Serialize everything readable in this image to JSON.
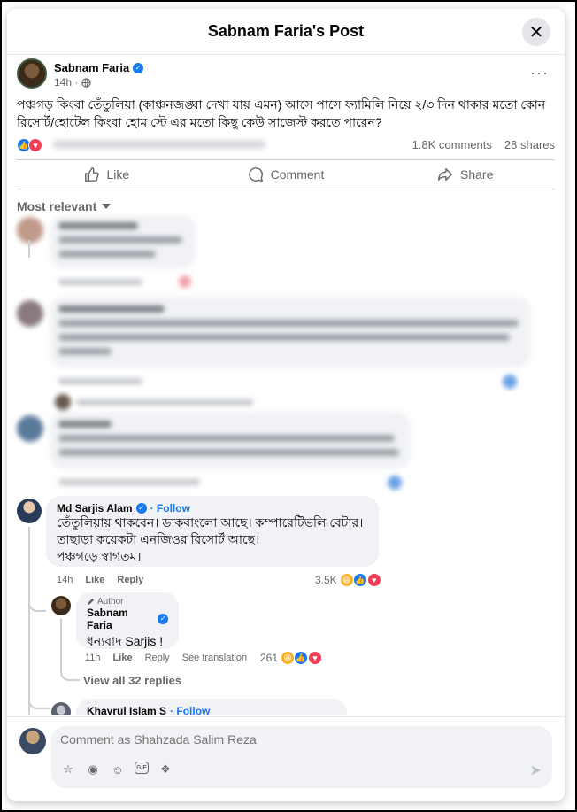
{
  "modal": {
    "title": "Sabnam Faria's Post",
    "close_label": "✕"
  },
  "post": {
    "author": "Sabnam Faria",
    "time": "14h ·",
    "more": "···",
    "text": "পঞ্চগড় কিংবা তেঁতুলিয়া (কাঞ্চনজঙ্ঘা দেখা যায় এমন) আসে পাসে ফ্যামিলি নিয়ে ২/৩ দিন থাকার মতো কোন রিসোর্ট/হোটেল কিংবা হোম স্টে এর মতো কিছু কেউ সাজেস্ট করতে পারেন?",
    "comments_count": "1.8K comments",
    "shares_count": "28 shares"
  },
  "actions": {
    "like": "Like",
    "comment": "Comment",
    "share": "Share"
  },
  "sort": {
    "label": "Most relevant"
  },
  "comments": [
    {
      "name": "Md Sarjis Alam",
      "follow": "· Follow",
      "lines": [
        "তেঁতুলিয়ায় থাকবেন। ডাকবাংলো আছে। কম্পারেটিভলি বেটার।",
        "তাছাড়া কয়েকটা এনজিওর রিসোর্ট আছে।",
        "পঞ্চগড়ে স্বাগতম।"
      ],
      "time": "14h",
      "like": "Like",
      "reply": "Reply",
      "reactions": "3.5K"
    }
  ],
  "reply": {
    "author_tag": "Author",
    "name": "Sabnam Faria",
    "text": "ধন্যবাদ Sarjis !",
    "time": "11h",
    "like": "Like",
    "reply": "Reply",
    "see_translation": "See translation",
    "reactions": "261"
  },
  "view_replies": "View all 32 replies",
  "next_comment": {
    "name": "Khayrul Islam S",
    "follow": "· Follow"
  },
  "compose": {
    "placeholder": "Comment as Shahzada Salim Reza"
  },
  "colors": {
    "accent": "#1877f2",
    "love": "#f33e58",
    "haha": "#f7b125",
    "bubble": "#f0f2f5",
    "secondary_text": "#65676b"
  }
}
